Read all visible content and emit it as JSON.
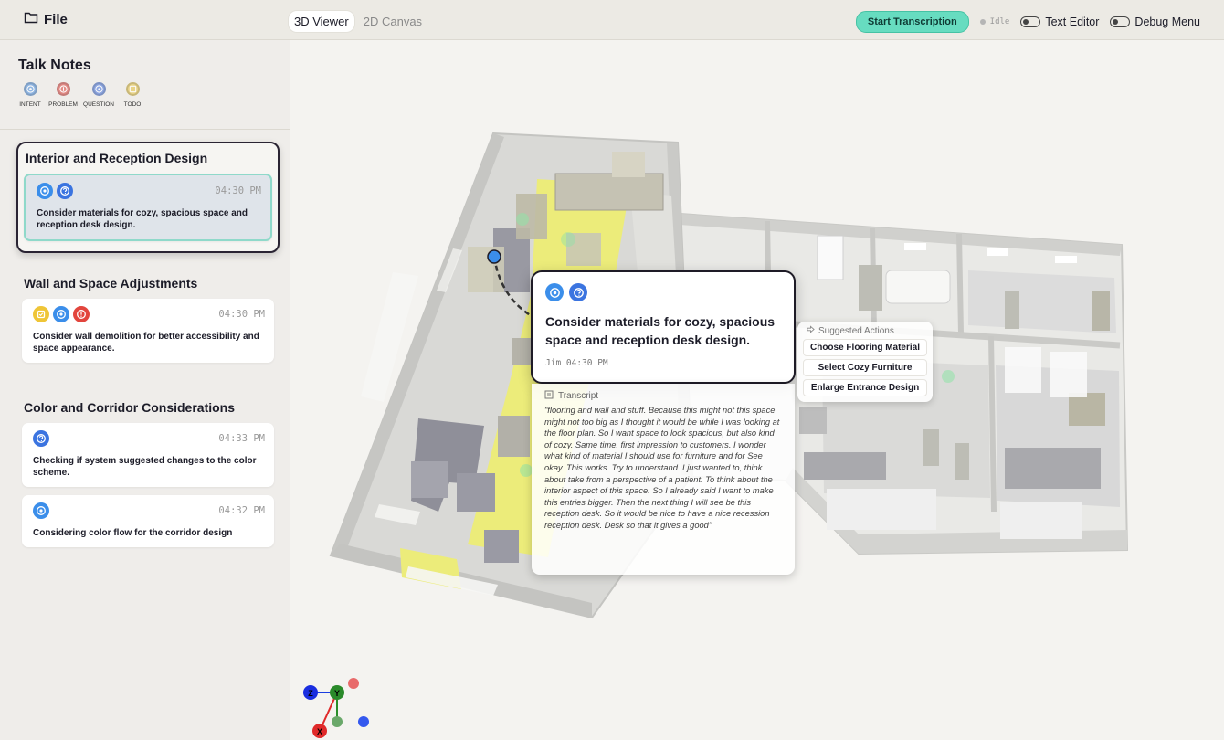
{
  "topbar": {
    "file_label": "File",
    "tabs": [
      {
        "label": "3D Viewer",
        "active": true
      },
      {
        "label": "2D Canvas",
        "active": false
      }
    ],
    "start_button": "Start Transcription",
    "status": "Idle",
    "toggles": [
      {
        "label": "Text Editor"
      },
      {
        "label": "Debug Menu"
      }
    ]
  },
  "sidebar": {
    "title": "Talk Notes",
    "legend": [
      {
        "label": "INTENT",
        "icon": "target-icon",
        "color": "#3b8eea"
      },
      {
        "label": "PROBLEM",
        "icon": "alert-icon",
        "color": "#e2453d"
      },
      {
        "label": "QUESTION",
        "icon": "question-icon",
        "color": "#3b74e0"
      },
      {
        "label": "TODO",
        "icon": "checkbox-icon",
        "color": "#efc537"
      }
    ],
    "groups": [
      {
        "title": "Interior and Reception Design",
        "notes": [
          {
            "time": "04:30 PM",
            "text": "Consider materials for cozy, spacious space and reception desk design.",
            "icons": [
              "intent",
              "question"
            ]
          }
        ]
      },
      {
        "title": "Wall and Space Adjustments",
        "notes": [
          {
            "time": "04:30 PM",
            "text": "Consider wall demolition for better accessibility and space appearance.",
            "icons": [
              "todo",
              "intent",
              "problem"
            ]
          }
        ]
      },
      {
        "title": "Color and Corridor Considerations",
        "notes": [
          {
            "time": "04:33 PM",
            "text": "Checking if system suggested changes to the color scheme.",
            "icons": [
              "question"
            ]
          },
          {
            "time": "04:32 PM",
            "text": "Considering color flow for the corridor design",
            "icons": [
              "intent"
            ]
          }
        ]
      }
    ]
  },
  "popup": {
    "text": "Consider materials for cozy, spacious space and reception desk design.",
    "meta": "Jim 04:30 PM",
    "transcript_label": "Transcript",
    "transcript": "\"flooring and wall and stuff. Because this might not this space might not too big as I thought it would be while I was looking at the floor plan. So I want space to look spacious, but also kind of cozy. Same time. first impression to customers. I wonder what kind of material I should use for furniture and for See okay. This works. Try to understand. I just wanted to, think about take from a perspective of a patient. To think about the interior aspect of this space. So I already said I want to make this entries bigger. Then the next thing I will see be this reception desk. So it would be nice to have a nice recession reception desk. Desk so that it gives a good\""
  },
  "actions": {
    "label": "Suggested Actions",
    "items": [
      "Choose Flooring Material",
      "Select Cozy Furniture",
      "Enlarge Entrance Design"
    ]
  },
  "axes": {
    "x": "X",
    "y": "Y",
    "z": "Z"
  },
  "colors": {
    "accent": "#67dcc0",
    "floor_highlight": "#ecec7a",
    "intent": "#3b8eea",
    "problem": "#e2453d",
    "question": "#3b74e0",
    "todo": "#efc537"
  }
}
